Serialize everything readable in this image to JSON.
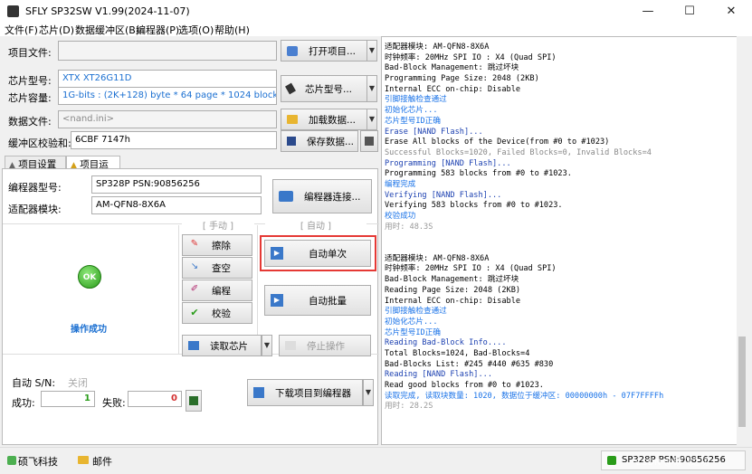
{
  "window": {
    "title": "SFLY SP32SW V1.99(2024-11-07)",
    "minimize": "—",
    "maximize": "☐",
    "close": "✕"
  },
  "menu": [
    "文件(F)",
    "芯片(D)",
    "数据缓冲区(B)",
    "编程器(P)",
    "选项(O)",
    "帮助(H)"
  ],
  "project": {
    "file_label": "项目文件:",
    "file_value": "",
    "open_button": "打开项目...",
    "chip_model_label": "芯片型号:",
    "chip_model_value": "XTX XT26G11D",
    "chip_capacity_label": "芯片容量:",
    "chip_capacity_value": "1G-bits : (2K+128) byte * 64 page * 1024 block",
    "chip_button": "芯片型号...",
    "data_file_label": "数据文件:",
    "data_file_value": "<nand.ini>",
    "load_button": "加载数据...",
    "checksum_label": "缓冲区校验和:",
    "checksum_value": "6CBF 7147h",
    "save_button": "保存数据..."
  },
  "tabs": [
    "项目设置",
    "项目运行"
  ],
  "run": {
    "programmer_model_label": "编程器型号:",
    "programmer_model_value": "SP328P  PSN:90856256",
    "adapter_label": "适配器模块:",
    "adapter_value": "AM-QFN8-8X6A",
    "connect_button": "编程器连接...",
    "manual_label": "[ 手动 ]",
    "auto_label": "[ 自动 ]",
    "ok_text": "OK",
    "status_text": "操作成功",
    "erase": "擦除",
    "blank": "查空",
    "program": "编程",
    "verify": "校验",
    "auto_single": "自动单次",
    "auto_batch": "自动批量",
    "read_chip": "读取芯片",
    "stop": "停止操作",
    "auto_sn_label": "自动 S/N:",
    "auto_sn_value": "关闭",
    "success_label": "成功:",
    "success_count": "1",
    "fail_label": "失败:",
    "fail_count": "0",
    "download_button": "下载项目到编程器"
  },
  "log": [
    {
      "t": "适配器模块: AM-QFN8-8X6A",
      "c": "#000"
    },
    {
      "t": "时钟频率: 20MHz    SPI IO : X4 (Quad SPI)",
      "c": "#000"
    },
    {
      "t": "Bad-Block Management: 跳过坏块",
      "c": "#000"
    },
    {
      "t": "Programming Page Size: 2048 (2KB)",
      "c": "#000"
    },
    {
      "t": "Internal ECC on-chip: Disable",
      "c": "#000"
    },
    {
      "t": "引脚接触检查通过",
      "c": "#1a73e8"
    },
    {
      "t": "初始化芯片...",
      "c": "#1a73e8"
    },
    {
      "t": "芯片型号ID正确",
      "c": "#1a73e8"
    },
    {
      "t": "Erase [NAND Flash]...",
      "c": "#1a3fb0"
    },
    {
      "t": "Erase All blocks of the Device(from #0 to #1023)",
      "c": "#000"
    },
    {
      "t": "Successful Blocks=1020, Failed Blocks=0, Invalid Blocks=4",
      "c": "#888"
    },
    {
      "t": "Programming [NAND Flash]...",
      "c": "#1a3fb0"
    },
    {
      "t": "Programming 583 blocks from #0 to #1023.",
      "c": "#000"
    },
    {
      "t": "编程完成",
      "c": "#1a73e8"
    },
    {
      "t": "Verifying [NAND Flash]...",
      "c": "#1a3fb0"
    },
    {
      "t": "Verifying 583 blocks from #0 to #1023.",
      "c": "#000"
    },
    {
      "t": "校验成功",
      "c": "#1a73e8"
    },
    {
      "t": "用时: 48.3S",
      "c": "#999"
    },
    {
      "t": "",
      "c": "#000"
    },
    {
      "t": "",
      "c": "#000"
    },
    {
      "t": "适配器模块: AM-QFN8-8X6A",
      "c": "#000"
    },
    {
      "t": "时钟频率: 20MHz    SPI IO : X4 (Quad SPI)",
      "c": "#000"
    },
    {
      "t": "Bad-Block Management: 跳过坏块",
      "c": "#000"
    },
    {
      "t": "Reading Page Size: 2048 (2KB)",
      "c": "#000"
    },
    {
      "t": "Internal ECC on-chip: Disable",
      "c": "#000"
    },
    {
      "t": "引脚接触检查通过",
      "c": "#1a73e8"
    },
    {
      "t": "初始化芯片...",
      "c": "#1a73e8"
    },
    {
      "t": "芯片型号ID正确",
      "c": "#1a73e8"
    },
    {
      "t": "Reading Bad-Block Info....",
      "c": "#1a3fb0"
    },
    {
      "t": "Total Blocks=1024, Bad-Blocks=4",
      "c": "#000"
    },
    {
      "t": "Bad-Blocks List: #245 #440 #635 #830",
      "c": "#000"
    },
    {
      "t": "Reading [NAND Flash]...",
      "c": "#1a3fb0"
    },
    {
      "t": "Read good blocks from #0 to #1023.",
      "c": "#000"
    },
    {
      "t": "读取完成, 读取块数量: 1020, 数据位于缓冲区: 00000000h - 07F7FFFFh",
      "c": "#1a73e8"
    },
    {
      "t": "用时: 28.2S",
      "c": "#999"
    }
  ],
  "status": {
    "left1": "硕飞科技",
    "left2": "邮件",
    "right": "SP328P PSN:90856256",
    "watermark": "CSDN @硕飞之功"
  }
}
